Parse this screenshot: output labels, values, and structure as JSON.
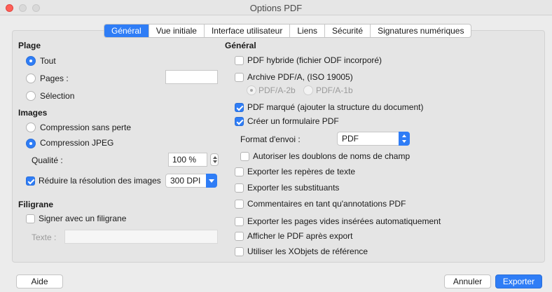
{
  "window": {
    "title": "Options PDF"
  },
  "tabs": [
    "Général",
    "Vue initiale",
    "Interface utilisateur",
    "Liens",
    "Sécurité",
    "Signatures numériques"
  ],
  "left": {
    "plage": {
      "heading": "Plage",
      "tout": "Tout",
      "pages": "Pages :",
      "pages_value": "",
      "selection": "Sélection"
    },
    "images": {
      "heading": "Images",
      "lossless": "Compression sans perte",
      "jpeg": "Compression JPEG",
      "quality_label": "Qualité :",
      "quality_value": "100 %",
      "reduce_label": "Réduire la résolution des images",
      "dpi_value": "300 DPI"
    },
    "filigrane": {
      "heading": "Filigrane",
      "sign_label": "Signer avec un filigrane",
      "text_label": "Texte :",
      "text_value": ""
    }
  },
  "right": {
    "heading": "Général",
    "hybrid": "PDF hybride (fichier ODF incorporé)",
    "archive": "Archive PDF/A, (ISO 19005)",
    "pdfa2b": "PDF/A-2b",
    "pdfa1b": "PDF/A-1b",
    "tagged": "PDF marqué (ajouter la structure du document)",
    "form": "Créer un formulaire PDF",
    "format_label": "Format d'envoi :",
    "format_value": "PDF",
    "allow_dup": "Autoriser les doublons de noms de champ",
    "bookmarks": "Exporter les repères de texte",
    "placeholders": "Exporter les substituants",
    "comments": "Commentaires en tant qu'annotations PDF",
    "empty_pages": "Exporter les pages vides insérées automatiquement",
    "view_after": "Afficher le PDF après export",
    "xobjects": "Utiliser les XObjets de référence"
  },
  "footer": {
    "help": "Aide",
    "cancel": "Annuler",
    "export": "Exporter"
  },
  "colors": {
    "accent": "#2f7df6",
    "close": "#ff5f57"
  }
}
